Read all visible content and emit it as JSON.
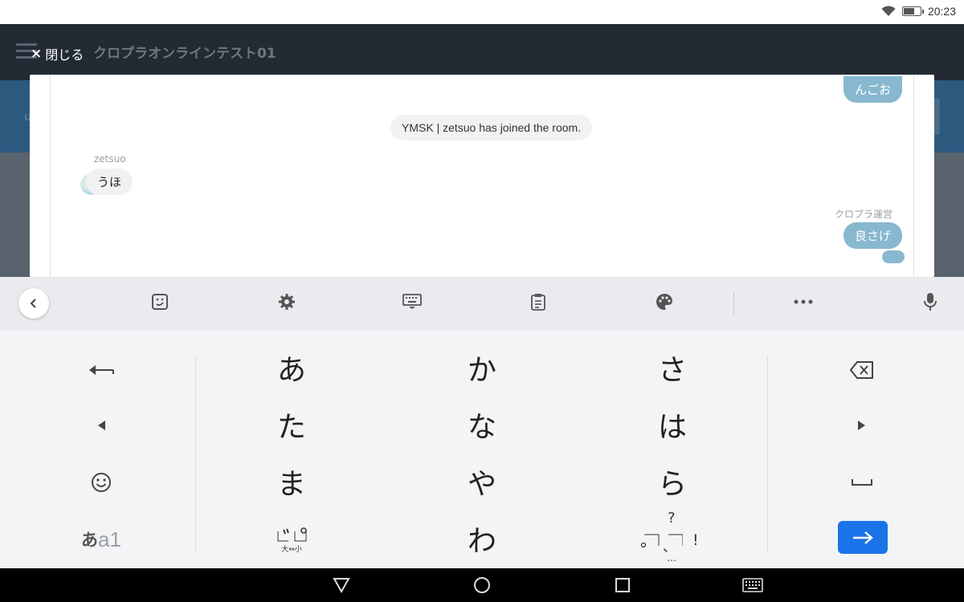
{
  "status_bar": {
    "time": "20:23",
    "battery_level": 0.7
  },
  "app": {
    "title": "クロプラオンラインテスト01",
    "close_label": "閉じる",
    "close_icon": "×",
    "left_partial": "u"
  },
  "chat": {
    "messages": [
      {
        "type": "outgoing",
        "text": "んごお"
      },
      {
        "type": "system",
        "text": "YMSK | zetsuo has joined the room."
      },
      {
        "type": "incoming",
        "sender": "zetsuo",
        "text": "うほ"
      },
      {
        "type": "outgoing",
        "sender": "クロプラ運営",
        "text": "良さげ"
      },
      {
        "type": "outgoing",
        "text": ""
      }
    ]
  },
  "keyboard": {
    "toolbar_icons": [
      "back-icon",
      "sticker-icon",
      "settings-icon",
      "keyboard-icon",
      "clipboard-icon",
      "palette-icon",
      "more-icon",
      "microphone-icon"
    ],
    "kana_rows": [
      [
        "あ",
        "か",
        "さ"
      ],
      [
        "た",
        "な",
        "は"
      ],
      [
        "ま",
        "や",
        "ら"
      ]
    ],
    "bottom": {
      "mode_label_a": "あ",
      "mode_label_b": "a1",
      "dakuten_sub": "大⇔小",
      "wa": "わ",
      "punct_top": "?",
      "punct_left": "、",
      "punct_right": "!",
      "punct_dots": "…"
    },
    "left_keys": [
      "undo-arrow-icon",
      "cursor-left-icon",
      "emoji-icon",
      "mode-toggle"
    ],
    "right_keys": [
      "backspace-icon",
      "cursor-right-icon",
      "space-icon",
      "enter-icon"
    ]
  },
  "navbar": {
    "buttons": [
      "back-nav-icon",
      "home-nav-icon",
      "recents-nav-icon",
      "keyboard-switch-icon"
    ]
  }
}
